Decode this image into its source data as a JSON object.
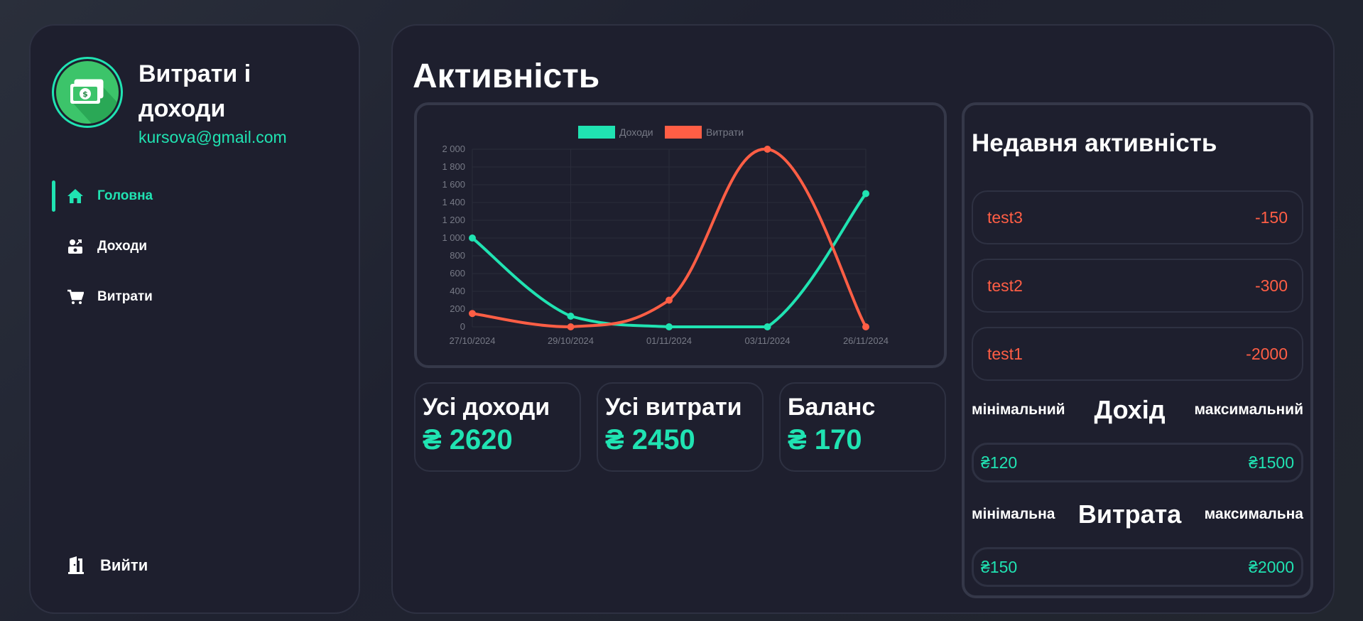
{
  "sidebar": {
    "app_title": "Витрати і доходи",
    "email": "kursova@gmail.com",
    "items": [
      {
        "label": "Головна",
        "icon": "home-icon",
        "active": true
      },
      {
        "label": "Доходи",
        "icon": "income-icon",
        "active": false
      },
      {
        "label": "Витрати",
        "icon": "cart-icon",
        "active": false
      }
    ],
    "logout_label": "Вийти"
  },
  "main": {
    "title": "Активність"
  },
  "chart_data": {
    "type": "line",
    "categories": [
      "27/10/2024",
      "29/10/2024",
      "01/11/2024",
      "03/11/2024",
      "26/11/2024"
    ],
    "series": [
      {
        "name": "Доходи",
        "color": "#20e3b2",
        "values": [
          1000,
          120,
          0,
          0,
          1500
        ]
      },
      {
        "name": "Витрати",
        "color": "#ff5e45",
        "values": [
          150,
          0,
          300,
          2000,
          0
        ]
      }
    ],
    "yticks": [
      "0",
      "200",
      "400",
      "600",
      "800",
      "1 000",
      "1 200",
      "1 400",
      "1 600",
      "1 800",
      "2 000"
    ],
    "ylim": [
      0,
      2000
    ],
    "grid": true,
    "legend": "top-center"
  },
  "stats": {
    "income_label": "Усі доходи",
    "income_value": "₴ 2620",
    "expense_label": "Усі витрати",
    "expense_value": "₴ 2450",
    "balance_label": "Баланс",
    "balance_value": "₴ 170"
  },
  "activity": {
    "title": "Недавня активність",
    "items": [
      {
        "name": "test3",
        "amount": "-150"
      },
      {
        "name": "test2",
        "amount": "-300"
      },
      {
        "name": "test1",
        "amount": "-2000"
      }
    ],
    "income_range": {
      "min_label": "мінімальний",
      "title": "Дохід",
      "max_label": "максимальний",
      "min_value": "₴120",
      "max_value": "₴1500"
    },
    "expense_range": {
      "min_label": "мінімальна",
      "title": "Витрата",
      "max_label": "максимальна",
      "min_value": "₴150",
      "max_value": "₴2000"
    }
  },
  "colors": {
    "accent": "#20e3b2",
    "expense": "#ff5e45",
    "panel": "#1e1f2e"
  }
}
